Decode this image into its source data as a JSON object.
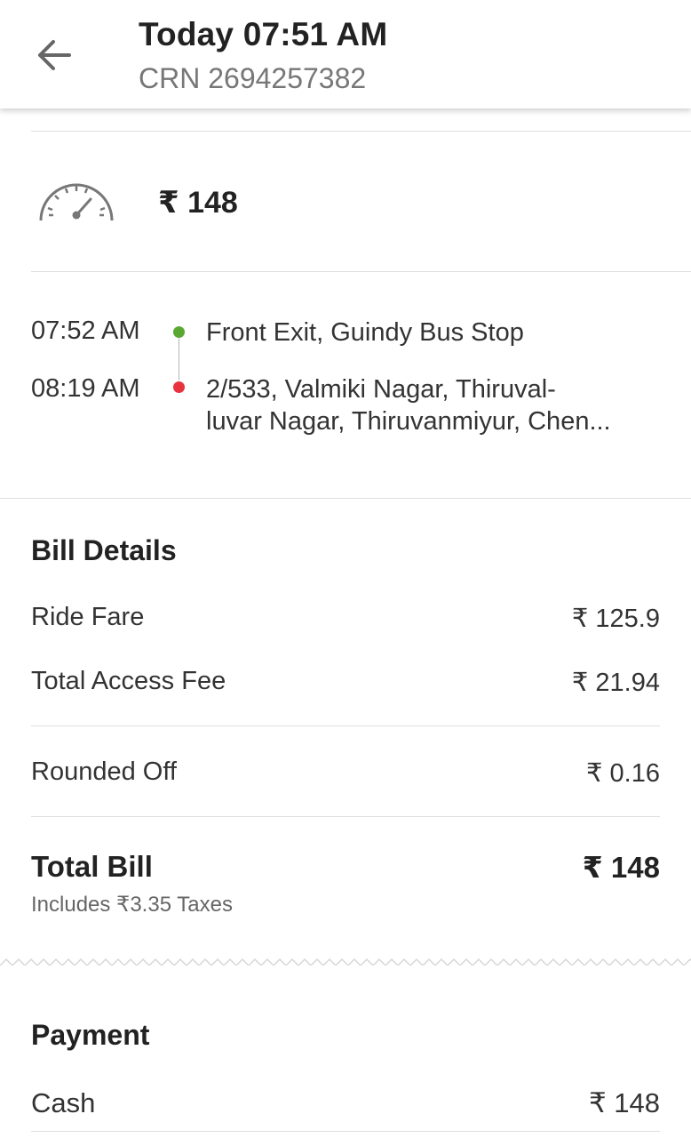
{
  "header": {
    "title": "Today 07:51 AM",
    "subtitle": "CRN 2694257382",
    "back_icon": "arrow-left-icon"
  },
  "fare": {
    "icon": "speedometer-icon",
    "amount": "₹ 148"
  },
  "trip": {
    "pickup": {
      "time": "07:52 AM",
      "address": "Front Exit, Guindy Bus Stop",
      "dot_color": "#5aa832"
    },
    "drop": {
      "time": "08:19 AM",
      "address_line1": "2/533, Valmiki Nagar, Thiruval-",
      "address_line2": "luvar Nagar, Thiruvanmiyur, Chen...",
      "dot_color": "#e8333e"
    }
  },
  "bill": {
    "title": "Bill Details",
    "rows": [
      {
        "label": "Ride Fare",
        "value": "₹ 125.9"
      },
      {
        "label": "Total Access Fee",
        "value": "₹ 21.94"
      },
      {
        "label": "Rounded Off",
        "value": "₹ 0.16"
      }
    ],
    "total_label": "Total Bill",
    "total_value": "₹ 148",
    "tax_note": "Includes ₹3.35 Taxes"
  },
  "payment": {
    "title": "Payment",
    "method": "Cash",
    "amount": "₹ 148"
  }
}
